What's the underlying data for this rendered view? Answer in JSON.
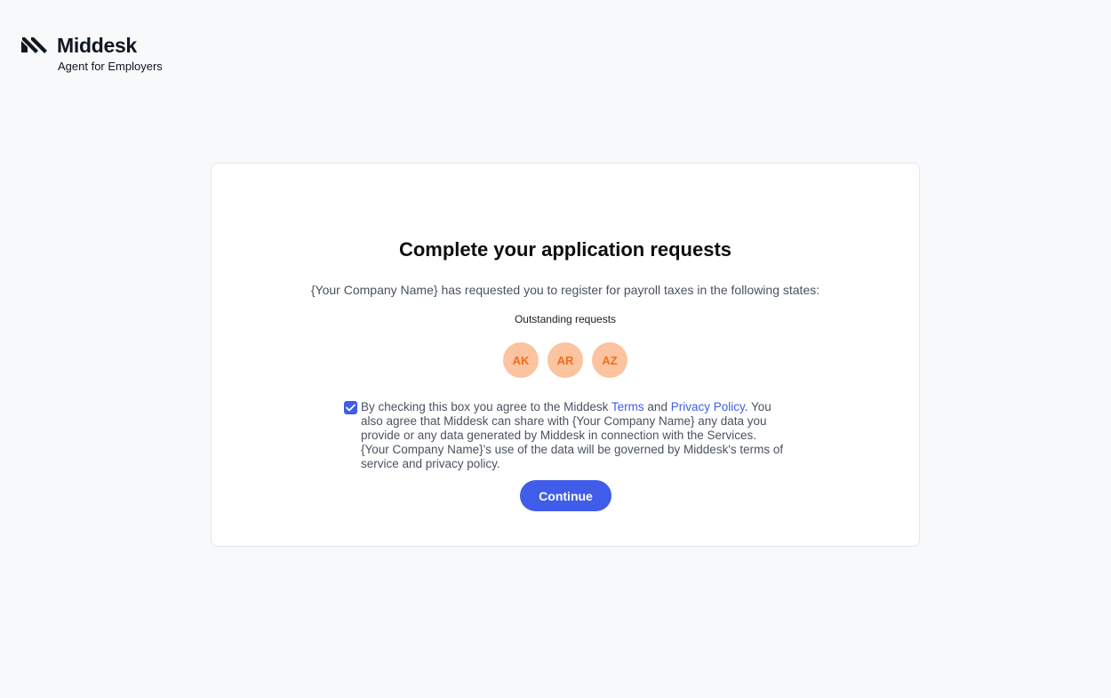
{
  "brand": {
    "name": "Middesk",
    "subtitle": "Agent for Employers"
  },
  "card": {
    "title": "Complete your application requests",
    "description": "{Your Company Name} has requested you to register for payroll taxes in the following states:",
    "outstanding_label": "Outstanding requests",
    "states": [
      "AK",
      "AR",
      "AZ"
    ]
  },
  "consent": {
    "checked": true,
    "text_before": "By checking this box you agree to the Middesk ",
    "terms_link": "Terms",
    "and": " and ",
    "privacy_link": "Privacy Policy",
    "text_after": ". You also agree that Middesk can share with {Your Company Name} any data you provide or any data generated by Middesk in connection with the Services. {Your Company Name}'s use of the data will be governed by Middesk's terms of service and privacy policy."
  },
  "actions": {
    "continue_label": "Continue"
  },
  "colors": {
    "accent": "#3f5de8",
    "badge_bg": "#fbc39f",
    "badge_text": "#f36c1c",
    "page_bg": "#f8f9fb"
  }
}
